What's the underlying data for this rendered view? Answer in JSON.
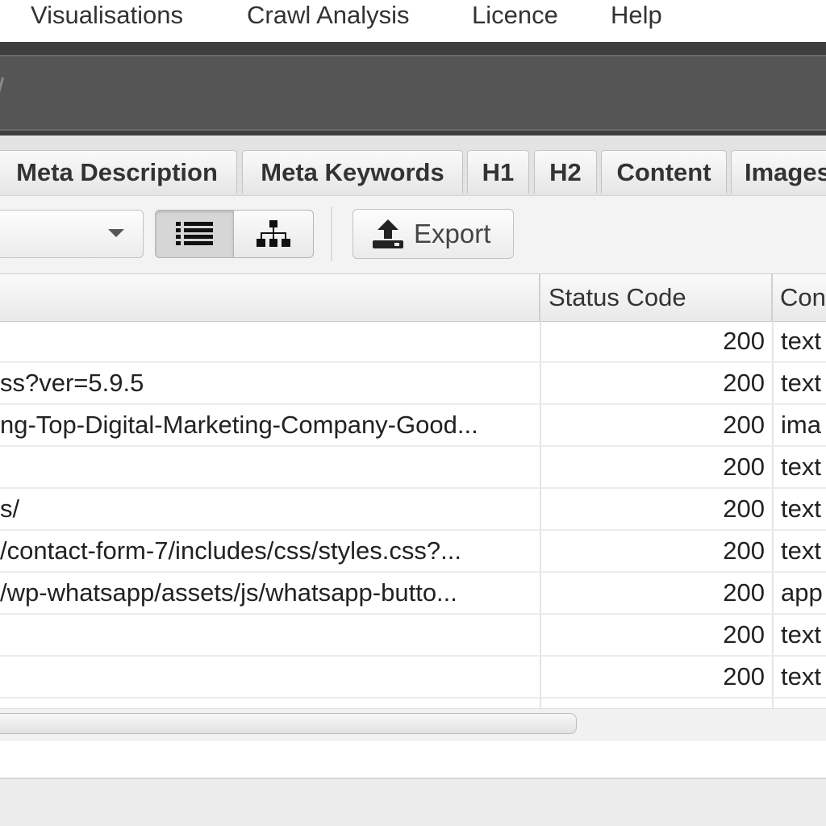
{
  "menubar": {
    "items": [
      {
        "label": "Visualisations"
      },
      {
        "label": "Crawl Analysis"
      },
      {
        "label": "Licence"
      },
      {
        "label": "Help"
      }
    ]
  },
  "urlbar": {
    "text": "/"
  },
  "tabs": [
    {
      "label": "Meta Description"
    },
    {
      "label": "Meta Keywords"
    },
    {
      "label": "H1"
    },
    {
      "label": "H2"
    },
    {
      "label": "Content"
    },
    {
      "label": "Images"
    }
  ],
  "toolbar": {
    "list_view_icon": "list-icon",
    "tree_view_icon": "tree-icon",
    "export_icon": "upload-icon",
    "export_label": "Export"
  },
  "table": {
    "columns": [
      {
        "label": ""
      },
      {
        "label": "Status Code"
      },
      {
        "label": "Con"
      }
    ],
    "rows": [
      {
        "address": "",
        "status": "200",
        "type": "text"
      },
      {
        "address": "ss?ver=5.9.5",
        "status": "200",
        "type": "text"
      },
      {
        "address": "ng-Top-Digital-Marketing-Company-Good...",
        "status": "200",
        "type": "ima"
      },
      {
        "address": "",
        "status": "200",
        "type": "text"
      },
      {
        "address": "s/",
        "status": "200",
        "type": "text"
      },
      {
        "address": "/contact-form-7/includes/css/styles.css?...",
        "status": "200",
        "type": "text"
      },
      {
        "address": "/wp-whatsapp/assets/js/whatsapp-butto...",
        "status": "200",
        "type": "app"
      },
      {
        "address": "",
        "status": "200",
        "type": "text"
      },
      {
        "address": "",
        "status": "200",
        "type": "text"
      }
    ]
  }
}
